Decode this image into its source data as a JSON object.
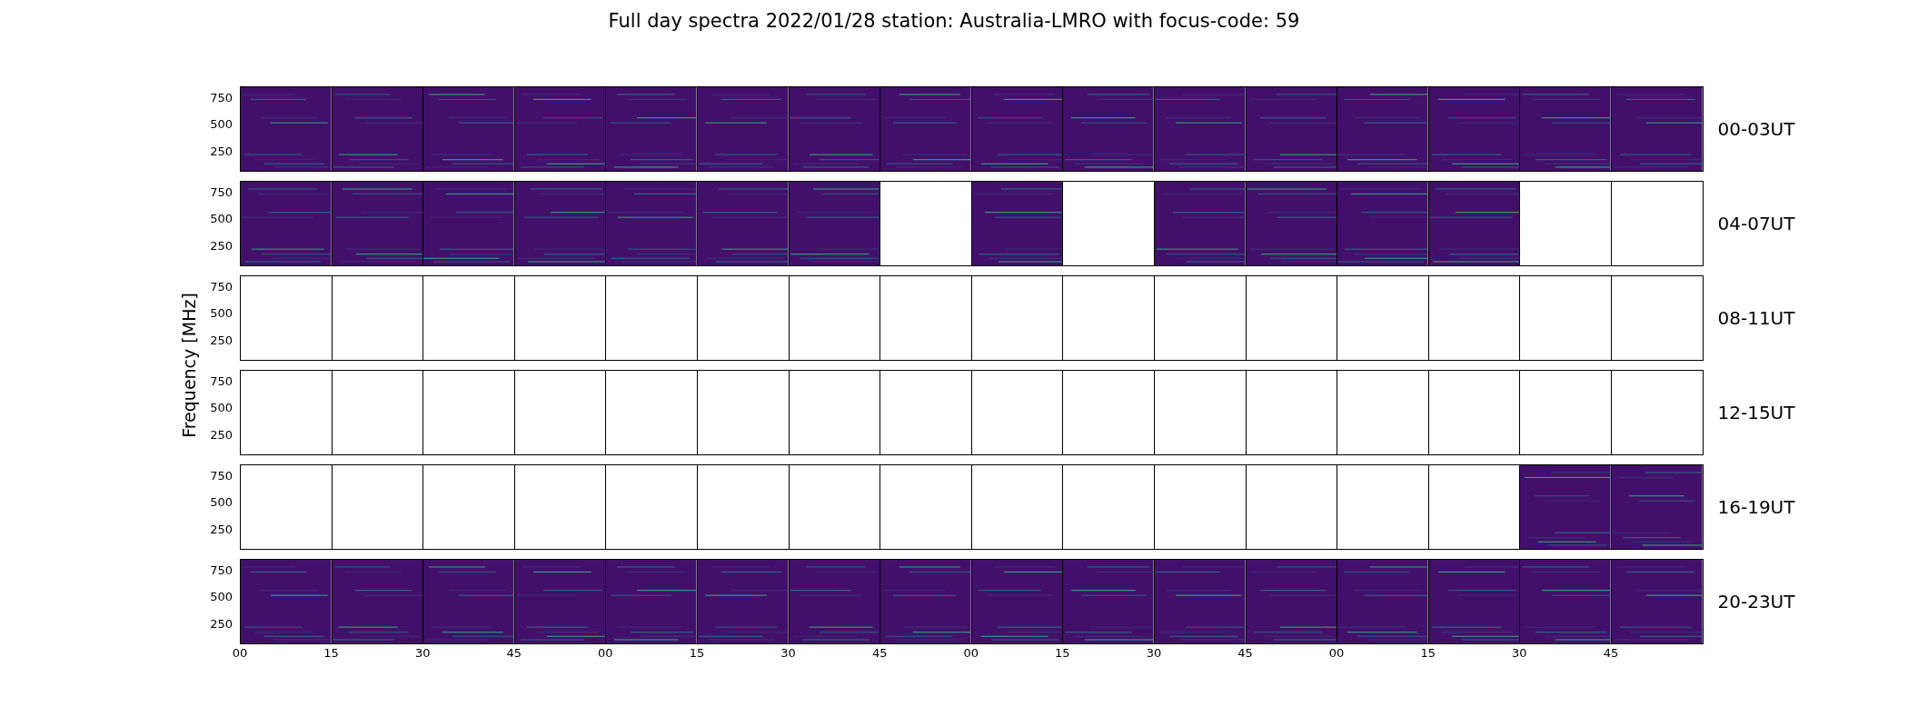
{
  "title": "Full day spectra 2022/01/28 station: Australia-LMRO with focus-code: 59",
  "y_axis_label": "Frequency [MHz]",
  "x_ticks": [
    "00",
    "15",
    "30",
    "45",
    "00",
    "15",
    "30",
    "45",
    "00",
    "15",
    "30",
    "45",
    "00",
    "15",
    "30",
    "45"
  ],
  "rows": [
    {
      "label": "00-03UT",
      "y_ticks": [
        "750",
        "500",
        "250"
      ],
      "panels": [
        {
          "has_data": true
        },
        {
          "has_data": true
        },
        {
          "has_data": true
        },
        {
          "has_data": true
        },
        {
          "has_data": true
        },
        {
          "has_data": true
        },
        {
          "has_data": true
        },
        {
          "has_data": true
        },
        {
          "has_data": true
        },
        {
          "has_data": true
        },
        {
          "has_data": true
        },
        {
          "has_data": true
        },
        {
          "has_data": true
        },
        {
          "has_data": true
        },
        {
          "has_data": true
        },
        {
          "has_data": true
        }
      ]
    },
    {
      "label": "04-07UT",
      "y_ticks": [
        "750",
        "500",
        "250"
      ],
      "panels": [
        {
          "has_data": true
        },
        {
          "has_data": true
        },
        {
          "has_data": true
        },
        {
          "has_data": true
        },
        {
          "has_data": true
        },
        {
          "has_data": true
        },
        {
          "has_data": true
        },
        {
          "has_data": false
        },
        {
          "has_data": true
        },
        {
          "has_data": false
        },
        {
          "has_data": true
        },
        {
          "has_data": true
        },
        {
          "has_data": true
        },
        {
          "has_data": true
        },
        {
          "has_data": false
        },
        {
          "has_data": false
        }
      ]
    },
    {
      "label": "08-11UT",
      "y_ticks": [
        "750",
        "500",
        "250"
      ],
      "panels": [
        {
          "has_data": false
        },
        {
          "has_data": false
        },
        {
          "has_data": false
        },
        {
          "has_data": false
        },
        {
          "has_data": false
        },
        {
          "has_data": false
        },
        {
          "has_data": false
        },
        {
          "has_data": false
        },
        {
          "has_data": false
        },
        {
          "has_data": false
        },
        {
          "has_data": false
        },
        {
          "has_data": false
        },
        {
          "has_data": false
        },
        {
          "has_data": false
        },
        {
          "has_data": false
        },
        {
          "has_data": false
        }
      ]
    },
    {
      "label": "12-15UT",
      "y_ticks": [
        "750",
        "500",
        "250"
      ],
      "panels": [
        {
          "has_data": false
        },
        {
          "has_data": false
        },
        {
          "has_data": false
        },
        {
          "has_data": false
        },
        {
          "has_data": false
        },
        {
          "has_data": false
        },
        {
          "has_data": false
        },
        {
          "has_data": false
        },
        {
          "has_data": false
        },
        {
          "has_data": false
        },
        {
          "has_data": false
        },
        {
          "has_data": false
        },
        {
          "has_data": false
        },
        {
          "has_data": false
        },
        {
          "has_data": false
        },
        {
          "has_data": false
        }
      ]
    },
    {
      "label": "16-19UT",
      "y_ticks": [
        "750",
        "500",
        "250"
      ],
      "panels": [
        {
          "has_data": false
        },
        {
          "has_data": false
        },
        {
          "has_data": false
        },
        {
          "has_data": false
        },
        {
          "has_data": false
        },
        {
          "has_data": false
        },
        {
          "has_data": false
        },
        {
          "has_data": false
        },
        {
          "has_data": false
        },
        {
          "has_data": false
        },
        {
          "has_data": false
        },
        {
          "has_data": false
        },
        {
          "has_data": false
        },
        {
          "has_data": false
        },
        {
          "has_data": true
        },
        {
          "has_data": true
        }
      ]
    },
    {
      "label": "20-23UT",
      "y_ticks": [
        "750",
        "500",
        "250"
      ],
      "panels": [
        {
          "has_data": true
        },
        {
          "has_data": true
        },
        {
          "has_data": true
        },
        {
          "has_data": true
        },
        {
          "has_data": true
        },
        {
          "has_data": true
        },
        {
          "has_data": true
        },
        {
          "has_data": true
        },
        {
          "has_data": true
        },
        {
          "has_data": true
        },
        {
          "has_data": true
        },
        {
          "has_data": true
        },
        {
          "has_data": true
        },
        {
          "has_data": true
        },
        {
          "has_data": true
        },
        {
          "has_data": true
        }
      ]
    }
  ]
}
